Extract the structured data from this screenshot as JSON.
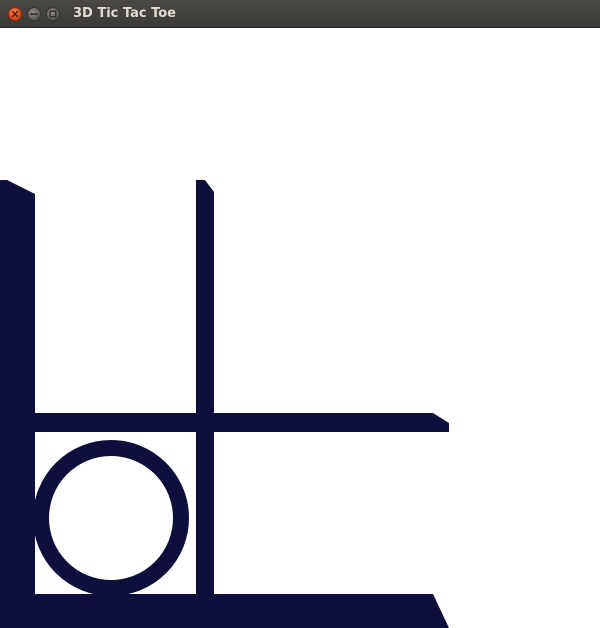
{
  "window": {
    "title": "3D Tic Tac Toe",
    "buttons": [
      "close",
      "minimize",
      "maximize"
    ]
  },
  "game": {
    "board_color": "#0e0f3d",
    "background_color": "#ffffff",
    "visible_cells": [
      {
        "row": "middle",
        "col": "left",
        "mark": "O"
      }
    ]
  }
}
